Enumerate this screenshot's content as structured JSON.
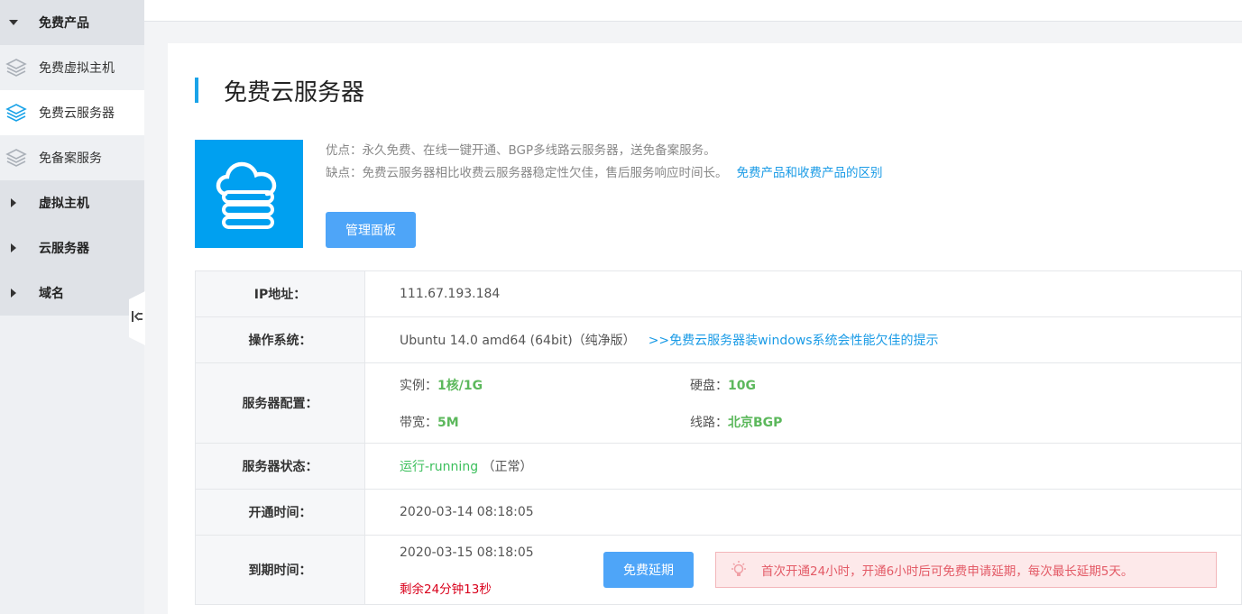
{
  "sidebar": {
    "groups": [
      {
        "label": "免费产品",
        "expanded": true
      },
      {
        "label": "虚拟主机",
        "expanded": false
      },
      {
        "label": "云服务器",
        "expanded": false
      },
      {
        "label": "域名",
        "expanded": false
      }
    ],
    "free_items": [
      {
        "label": "免费虚拟主机",
        "icon": "layers-icon",
        "active": false
      },
      {
        "label": "免费云服务器",
        "icon": "layers-icon",
        "active": true
      },
      {
        "label": "免备案服务",
        "icon": "layers-icon",
        "active": false
      }
    ]
  },
  "page": {
    "title": "免费云服务器",
    "pros": "优点：永久免费、在线一键开通、BGP多线路云服务器，送免备案服务。",
    "cons": "缺点：免费云服务器相比收费云服务器稳定性欠佳，售后服务响应时间长。",
    "diff_link": "免费产品和收费产品的区别",
    "manage_button": "管理面板",
    "product_icon": "cloud-server-icon"
  },
  "table": {
    "ip_label": "IP地址：",
    "ip_value": "111.67.193.184",
    "os_label": "操作系统：",
    "os_value": "Ubuntu 14.0 amd64 (64bit)（纯净版）",
    "os_tip_link": ">>免费云服务器装windows系统会性能欠佳的提示",
    "config_label": "服务器配置：",
    "instance_label": "实例：",
    "instance_value": "1核/1G",
    "disk_label": "硬盘：",
    "disk_value": "10G",
    "bandwidth_label": "带宽：",
    "bandwidth_value": "5M",
    "line_label": "线路：",
    "line_value": "北京BGP",
    "status_label": "服务器状态：",
    "status_value": "运行-running",
    "status_note": "（正常）",
    "open_label": "开通时间：",
    "open_value": "2020-03-14 08:18:05",
    "expire_label": "到期时间：",
    "expire_value": "2020-03-15 08:18:05",
    "remaining": "剩余24分钟13秒",
    "extend_button": "免费延期",
    "notice": "首次开通24小时，开通6小时后可免费申请延期，每次最长延期5天。"
  },
  "colors": {
    "accent": "#1aa3e8",
    "button": "#4ea5f8",
    "green": "#5cb85c",
    "red": "#d9001b"
  }
}
